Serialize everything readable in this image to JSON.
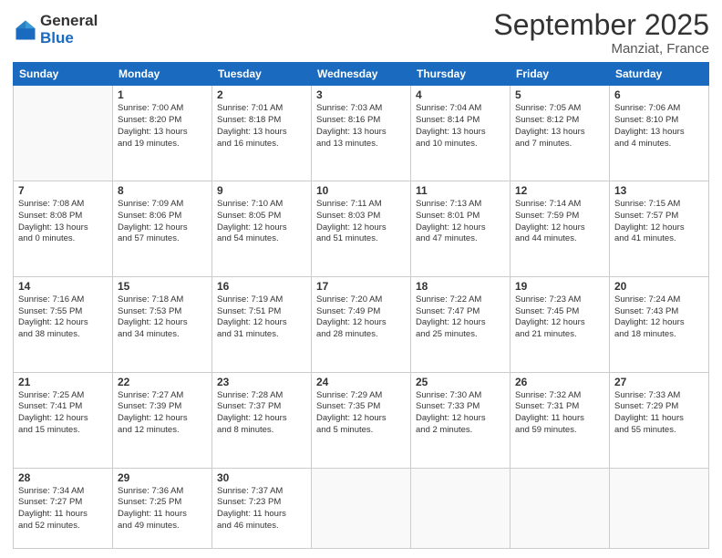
{
  "logo": {
    "general": "General",
    "blue": "Blue"
  },
  "title": {
    "month_year": "September 2025",
    "location": "Manziat, France"
  },
  "weekdays": [
    "Sunday",
    "Monday",
    "Tuesday",
    "Wednesday",
    "Thursday",
    "Friday",
    "Saturday"
  ],
  "weeks": [
    [
      {
        "day": "",
        "info": ""
      },
      {
        "day": "1",
        "info": "Sunrise: 7:00 AM\nSunset: 8:20 PM\nDaylight: 13 hours\nand 19 minutes."
      },
      {
        "day": "2",
        "info": "Sunrise: 7:01 AM\nSunset: 8:18 PM\nDaylight: 13 hours\nand 16 minutes."
      },
      {
        "day": "3",
        "info": "Sunrise: 7:03 AM\nSunset: 8:16 PM\nDaylight: 13 hours\nand 13 minutes."
      },
      {
        "day": "4",
        "info": "Sunrise: 7:04 AM\nSunset: 8:14 PM\nDaylight: 13 hours\nand 10 minutes."
      },
      {
        "day": "5",
        "info": "Sunrise: 7:05 AM\nSunset: 8:12 PM\nDaylight: 13 hours\nand 7 minutes."
      },
      {
        "day": "6",
        "info": "Sunrise: 7:06 AM\nSunset: 8:10 PM\nDaylight: 13 hours\nand 4 minutes."
      }
    ],
    [
      {
        "day": "7",
        "info": "Sunrise: 7:08 AM\nSunset: 8:08 PM\nDaylight: 13 hours\nand 0 minutes."
      },
      {
        "day": "8",
        "info": "Sunrise: 7:09 AM\nSunset: 8:06 PM\nDaylight: 12 hours\nand 57 minutes."
      },
      {
        "day": "9",
        "info": "Sunrise: 7:10 AM\nSunset: 8:05 PM\nDaylight: 12 hours\nand 54 minutes."
      },
      {
        "day": "10",
        "info": "Sunrise: 7:11 AM\nSunset: 8:03 PM\nDaylight: 12 hours\nand 51 minutes."
      },
      {
        "day": "11",
        "info": "Sunrise: 7:13 AM\nSunset: 8:01 PM\nDaylight: 12 hours\nand 47 minutes."
      },
      {
        "day": "12",
        "info": "Sunrise: 7:14 AM\nSunset: 7:59 PM\nDaylight: 12 hours\nand 44 minutes."
      },
      {
        "day": "13",
        "info": "Sunrise: 7:15 AM\nSunset: 7:57 PM\nDaylight: 12 hours\nand 41 minutes."
      }
    ],
    [
      {
        "day": "14",
        "info": "Sunrise: 7:16 AM\nSunset: 7:55 PM\nDaylight: 12 hours\nand 38 minutes."
      },
      {
        "day": "15",
        "info": "Sunrise: 7:18 AM\nSunset: 7:53 PM\nDaylight: 12 hours\nand 34 minutes."
      },
      {
        "day": "16",
        "info": "Sunrise: 7:19 AM\nSunset: 7:51 PM\nDaylight: 12 hours\nand 31 minutes."
      },
      {
        "day": "17",
        "info": "Sunrise: 7:20 AM\nSunset: 7:49 PM\nDaylight: 12 hours\nand 28 minutes."
      },
      {
        "day": "18",
        "info": "Sunrise: 7:22 AM\nSunset: 7:47 PM\nDaylight: 12 hours\nand 25 minutes."
      },
      {
        "day": "19",
        "info": "Sunrise: 7:23 AM\nSunset: 7:45 PM\nDaylight: 12 hours\nand 21 minutes."
      },
      {
        "day": "20",
        "info": "Sunrise: 7:24 AM\nSunset: 7:43 PM\nDaylight: 12 hours\nand 18 minutes."
      }
    ],
    [
      {
        "day": "21",
        "info": "Sunrise: 7:25 AM\nSunset: 7:41 PM\nDaylight: 12 hours\nand 15 minutes."
      },
      {
        "day": "22",
        "info": "Sunrise: 7:27 AM\nSunset: 7:39 PM\nDaylight: 12 hours\nand 12 minutes."
      },
      {
        "day": "23",
        "info": "Sunrise: 7:28 AM\nSunset: 7:37 PM\nDaylight: 12 hours\nand 8 minutes."
      },
      {
        "day": "24",
        "info": "Sunrise: 7:29 AM\nSunset: 7:35 PM\nDaylight: 12 hours\nand 5 minutes."
      },
      {
        "day": "25",
        "info": "Sunrise: 7:30 AM\nSunset: 7:33 PM\nDaylight: 12 hours\nand 2 minutes."
      },
      {
        "day": "26",
        "info": "Sunrise: 7:32 AM\nSunset: 7:31 PM\nDaylight: 11 hours\nand 59 minutes."
      },
      {
        "day": "27",
        "info": "Sunrise: 7:33 AM\nSunset: 7:29 PM\nDaylight: 11 hours\nand 55 minutes."
      }
    ],
    [
      {
        "day": "28",
        "info": "Sunrise: 7:34 AM\nSunset: 7:27 PM\nDaylight: 11 hours\nand 52 minutes."
      },
      {
        "day": "29",
        "info": "Sunrise: 7:36 AM\nSunset: 7:25 PM\nDaylight: 11 hours\nand 49 minutes."
      },
      {
        "day": "30",
        "info": "Sunrise: 7:37 AM\nSunset: 7:23 PM\nDaylight: 11 hours\nand 46 minutes."
      },
      {
        "day": "",
        "info": ""
      },
      {
        "day": "",
        "info": ""
      },
      {
        "day": "",
        "info": ""
      },
      {
        "day": "",
        "info": ""
      }
    ]
  ]
}
